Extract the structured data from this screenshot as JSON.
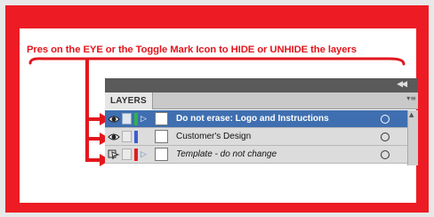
{
  "instruction_text": "Pres on the EYE  or the Toggle Mark Icon to HIDE or UNHIDE  the layers",
  "panel": {
    "tab_label": "LAYERS",
    "collapse_icon": "double-chevron-icon",
    "menu_icon": "panel-menu-icon"
  },
  "layers": [
    {
      "name": "Do not erase: Logo and Instructions",
      "visibility": "eye",
      "color": "#2fb34a",
      "selected": true,
      "expandable": true,
      "italic": false
    },
    {
      "name": "Customer's Design",
      "visibility": "eye",
      "color": "#3b5fd0",
      "selected": false,
      "expandable": false,
      "italic": false
    },
    {
      "name": "Template - do not change",
      "visibility": "template",
      "color": "#e02020",
      "selected": false,
      "expandable": true,
      "italic": true
    }
  ],
  "colors": {
    "accent_red": "#ed1c24",
    "selection_blue": "#3f6fb0"
  }
}
